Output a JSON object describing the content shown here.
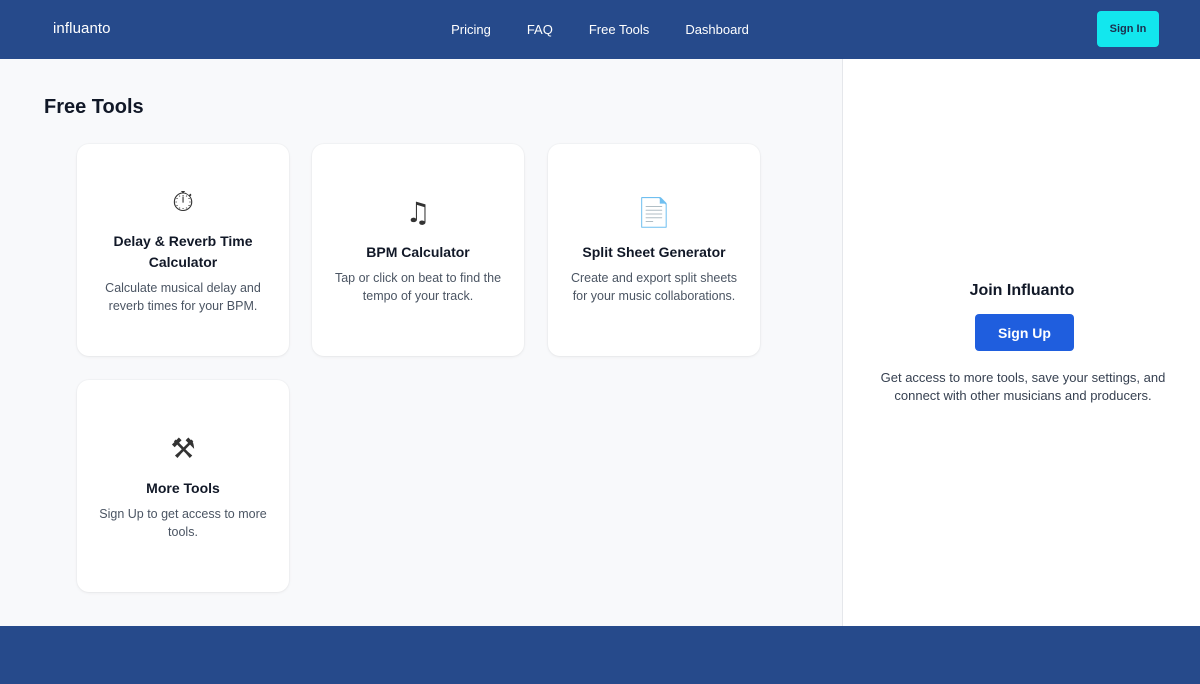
{
  "header": {
    "brand": "influanto",
    "nav": [
      "Pricing",
      "FAQ",
      "Free Tools",
      "Dashboard"
    ],
    "sign_in_label": "Sign In"
  },
  "main": {
    "title": "Free Tools",
    "cards": [
      {
        "icon": "stopwatch-icon",
        "glyph": "⏱",
        "title": "Delay & Reverb Time Calculator",
        "desc": "Calculate musical delay and reverb times for your BPM."
      },
      {
        "icon": "music-note-icon",
        "glyph": "♫",
        "title": "BPM Calculator",
        "desc": "Tap or click on beat to find the tempo of your track."
      },
      {
        "icon": "document-icon",
        "glyph": "📄",
        "title": "Split Sheet Generator",
        "desc": "Create and export split sheets for your music collaborations."
      },
      {
        "icon": "tools-icon",
        "glyph": "⚒",
        "title": "More Tools",
        "desc": "Sign Up to get access to more tools."
      }
    ]
  },
  "sidebar": {
    "title": "Join Influanto",
    "sign_up_label": "Sign Up",
    "desc": "Get access to more tools, save your settings, and connect with other musicians and producers."
  },
  "colors": {
    "header_bg": "#264a8b",
    "sign_in_bg": "#12e7ee",
    "sign_up_bg": "#1f5ede"
  }
}
